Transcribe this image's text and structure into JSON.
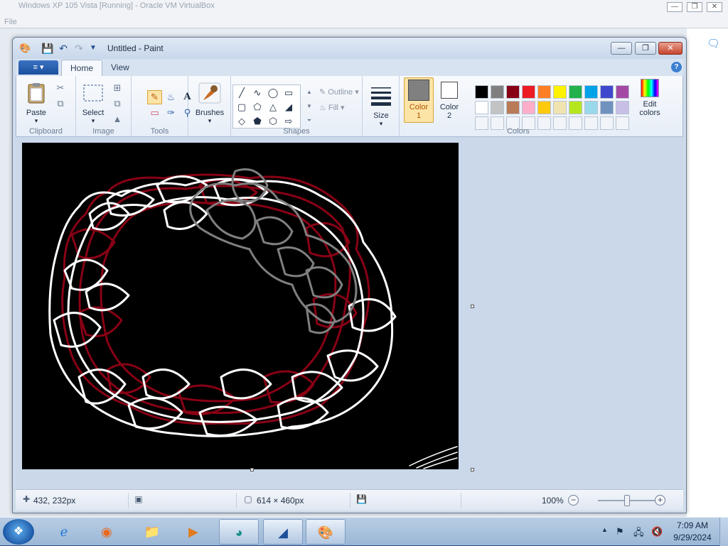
{
  "host": {
    "title": "Windows XP 105 Vista [Running] - Oracle VM VirtualBox",
    "file_menu": "File",
    "controls": [
      "—",
      "❐",
      "✕"
    ]
  },
  "window": {
    "title": "Untitled - Paint",
    "quick_access": [
      "save-icon",
      "undo-icon",
      "redo-icon",
      "customize-icon"
    ],
    "controls": [
      "—",
      "❐",
      "✕"
    ]
  },
  "tabs": {
    "file_menu_icon": "≡ ▾",
    "home": "Home",
    "view": "View",
    "help": "?"
  },
  "ribbon": {
    "clipboard": {
      "label": "Clipboard",
      "paste": "Paste",
      "dropdown": "▾"
    },
    "image": {
      "label": "Image",
      "select": "Select",
      "dropdown": "▾"
    },
    "tools": {
      "label": "Tools"
    },
    "brushes": {
      "label": "Brushes",
      "dropdown": "▾"
    },
    "shapes": {
      "label": "Shapes",
      "outline": "Outline",
      "fill": "Fill"
    },
    "size": {
      "label": "Size",
      "dropdown": "▾"
    },
    "colors": {
      "label": "Colors",
      "color1_label": "Color",
      "color1_num": "1",
      "color2_label": "Color",
      "color2_num": "2",
      "color1": "#808080",
      "color2": "#ffffff",
      "edit": "Edit",
      "edit2": "colors",
      "palette_row1": [
        "#000000",
        "#7f7f7f",
        "#880015",
        "#ed1c24",
        "#ff7f27",
        "#fff200",
        "#22b14c",
        "#00a2e8",
        "#3f48cc",
        "#a349a4"
      ],
      "palette_row2": [
        "#ffffff",
        "#c3c3c3",
        "#b97a57",
        "#ffaec9",
        "#ffc90e",
        "#efe4b0",
        "#b5e61d",
        "#99d9ea",
        "#7092be",
        "#c8bfe7"
      ]
    }
  },
  "status": {
    "cursor_pos": "432, 232px",
    "canvas_size": "614 × 460px",
    "zoom": "100%",
    "zoom_minus": "−",
    "zoom_plus": "+"
  },
  "taskbar": {
    "apps": [
      "internet-explorer",
      "firefox",
      "file-explorer",
      "media-player",
      "browser-app",
      "xp-mode",
      "paint"
    ],
    "time": "7:09 AM",
    "date": "9/29/2024"
  }
}
